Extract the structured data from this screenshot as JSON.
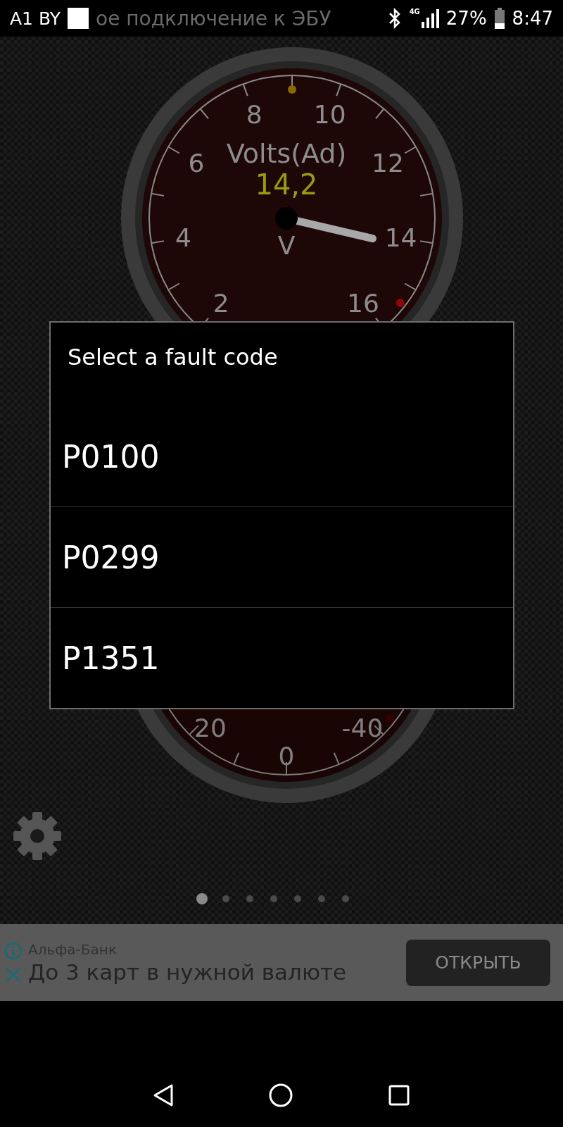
{
  "status_bar": {
    "carrier": "A1 BY",
    "notification": "ое подключение к ЭБУ",
    "network": "4G",
    "battery": "27%",
    "time": "8:47"
  },
  "gauges": [
    {
      "label": "Volts(Ad)",
      "value": "14,2",
      "unit": "V",
      "level": 0.789,
      "ticks": [
        "2",
        "4",
        "6",
        "8",
        "10",
        "12",
        "14",
        "16"
      ]
    },
    {
      "ticks": [
        "20",
        "0",
        "-40"
      ]
    }
  ],
  "dialog": {
    "title": "Select a fault code",
    "items": [
      "P0100",
      "P0299",
      "P1351"
    ]
  },
  "pages": [
    {
      "selected": true
    },
    {
      "selected": false
    },
    {
      "selected": false
    },
    {
      "selected": false
    },
    {
      "selected": false
    },
    {
      "selected": false
    },
    {
      "selected": false
    }
  ],
  "ad": {
    "advertiser": "Альфа-Банк",
    "headline": "До 3 карт в нужной валюте",
    "button": "ОТКРЫТЬ"
  }
}
